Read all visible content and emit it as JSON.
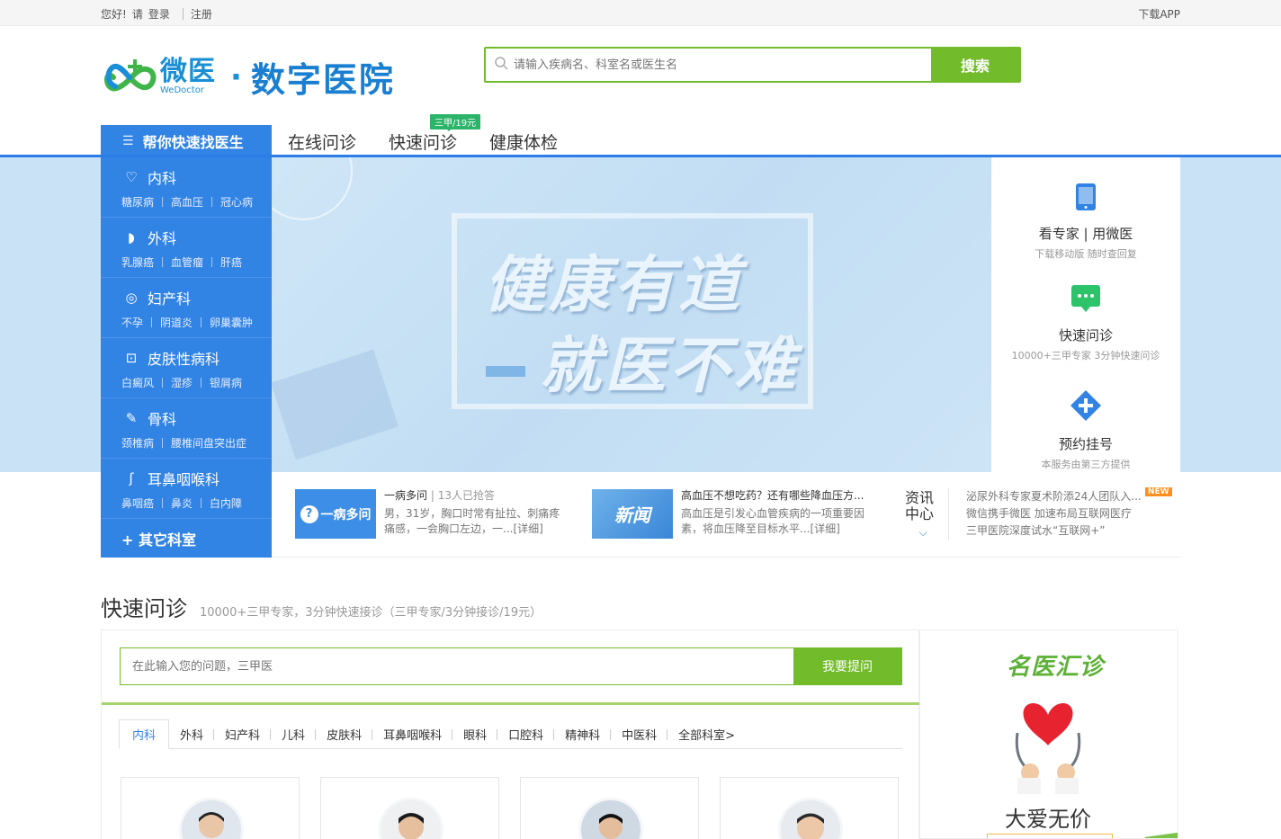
{
  "topbar": {
    "greeting": "您好!",
    "please": "请",
    "login": "登录",
    "register": "注册",
    "download": "下载APP"
  },
  "header": {
    "brand_cn": "微医",
    "brand_en": "WeDoctor",
    "dot": "·",
    "hospital": "数字医院",
    "search_placeholder": "请输入疾病名、科室名或医生名",
    "search_button": "搜索"
  },
  "nav": {
    "category_label": "帮你快速找医生",
    "items": [
      "在线问诊",
      "快速问诊",
      "健康体检"
    ],
    "badge": "三甲/19元"
  },
  "menu": [
    {
      "title": "内科",
      "icon": "heart-icon",
      "subs": [
        "糖尿病",
        "高血压",
        "冠心病"
      ]
    },
    {
      "title": "外科",
      "icon": "stomach-icon",
      "subs": [
        "乳腺癌",
        "血管瘤",
        "肝癌"
      ]
    },
    {
      "title": "妇产科",
      "icon": "uterus-icon",
      "subs": [
        "不孕",
        "阴道炎",
        "卵巢囊肿"
      ]
    },
    {
      "title": "皮肤性病科",
      "icon": "skin-icon",
      "subs": [
        "白癜风",
        "湿疹",
        "银屑病"
      ]
    },
    {
      "title": "骨科",
      "icon": "bone-icon",
      "subs": [
        "颈椎病",
        "腰椎间盘突出症"
      ]
    },
    {
      "title": "耳鼻咽喉科",
      "icon": "ear-icon",
      "subs": [
        "鼻咽癌",
        "鼻炎",
        "白内障"
      ]
    }
  ],
  "menu_other": "+ 其它科室",
  "hero": {
    "line1": "健康有道",
    "line2": "就医不难"
  },
  "right_panel": [
    {
      "title": "看专家 | 用微医",
      "sub": "下载移动版 随时查回复",
      "icon": "phone-icon"
    },
    {
      "title": "快速问诊",
      "sub": "10000+三甲专家 3分钟快速问诊",
      "icon": "chat-icon"
    },
    {
      "title": "预约挂号",
      "sub": "本服务由第三方提供",
      "icon": "plus-icon"
    }
  ],
  "strip": {
    "card1": "一病多问",
    "qa_head": "一病多问",
    "qa_count": "13人已抢答",
    "qa_body1": "男，31岁，胸口时常有扯拉、刺痛疼",
    "qa_body2": "痛感，一会胸口左边，一...[详细]",
    "card2": "新闻",
    "news_head": "高血压不想吃药？还有哪些降血压方...",
    "news_body1": "高血压是引发心血管疾病的一项重要因",
    "news_body2": "素，将血压降至目标水平...[详细]",
    "info_title": "资讯中心",
    "news_list": [
      "泌尿外科专家夏术阶添24人团队入...",
      "微信携手微医 加速布局互联网医疗",
      "三甲医院深度试水“互联网+”"
    ],
    "new_badge": "NEW"
  },
  "quick": {
    "title": "快速问诊",
    "subtitle": "10000+三甲专家，3分钟快速接诊（三甲专家/3分钟接诊/19元）",
    "ask_placeholder": "在此输入您的问题，三甲医",
    "ask_button": "我要提问",
    "tabs": [
      "内科",
      "外科",
      "妇产科",
      "儿科",
      "皮肤科",
      "耳鼻咽喉科",
      "眼科",
      "口腔科",
      "精神科",
      "中医科",
      "全部科室>"
    ]
  },
  "ad": {
    "logo": "名医汇诊",
    "slogan": "大爱无价"
  },
  "colors": {
    "blue": "#3183e4",
    "green": "#72bb2b",
    "banner": "#c9e2f5"
  }
}
